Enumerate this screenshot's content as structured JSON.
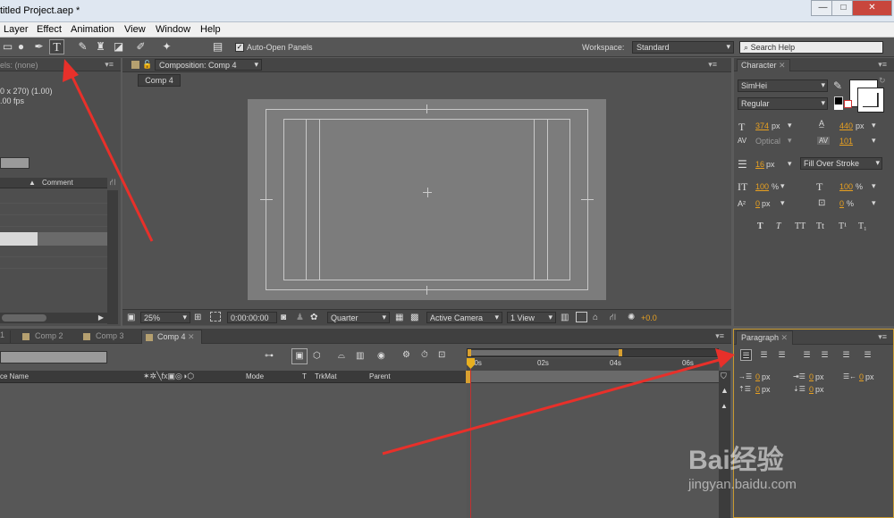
{
  "window": {
    "title": "titled Project.aep *",
    "min": "—",
    "max": "□",
    "close": "✕"
  },
  "menu": [
    "Layer",
    "Effect",
    "Animation",
    "View",
    "Window",
    "Help"
  ],
  "toolbar": {
    "auto_open_label": "Auto-Open Panels",
    "workspace_label": "Workspace:",
    "workspace_value": "Standard",
    "search_placeholder": "Search Help"
  },
  "project": {
    "header": "els: (none)",
    "info_line1": "0 x 270) (1.00)",
    "info_line2": ".00 fps",
    "comment_col": "Comment"
  },
  "composition": {
    "tab": "Composition: Comp 4",
    "comp_button": "Comp 4",
    "zoom": "25%",
    "timecode": "0:00:00:00",
    "resolution": "Quarter",
    "camera": "Active Camera",
    "view": "1 View",
    "exposure": "+0.0"
  },
  "character": {
    "tab": "Character",
    "font": "SimHei",
    "style": "Regular",
    "size": "374",
    "size_unit": "px",
    "leading": "440",
    "leading_unit": "px",
    "kerning": "Optical",
    "tracking": "101",
    "stroke_width": "16",
    "stroke_unit": "px",
    "stroke_mode": "Fill Over Stroke",
    "vscale": "100",
    "vscale_unit": "%",
    "hscale": "100",
    "hscale_unit": "%",
    "baseline": "0",
    "baseline_unit": "px",
    "tsume": "0",
    "tsume_unit": "%",
    "styles": [
      "T",
      "T",
      "TT",
      "Tt",
      "T¹",
      "T₁"
    ]
  },
  "timeline": {
    "tabs": [
      {
        "label": "1"
      },
      {
        "label": "Comp 2"
      },
      {
        "label": "Comp 3"
      },
      {
        "label": "Comp 4"
      }
    ],
    "source_col": "ce Name",
    "mode_col": "Mode",
    "t_col": "T",
    "trkmat_col": "TrkMat",
    "parent_col": "Parent",
    "ruler": [
      "00s",
      "02s",
      "04s",
      "06s"
    ]
  },
  "paragraph": {
    "tab": "Paragraph",
    "indent_left": "0",
    "indent_top": "0",
    "indent_right": "0",
    "space_before": "0",
    "space_after": "0",
    "unit": "px"
  },
  "watermark": {
    "brand": "Bai经验",
    "url": "jingyan.baidu.com"
  }
}
